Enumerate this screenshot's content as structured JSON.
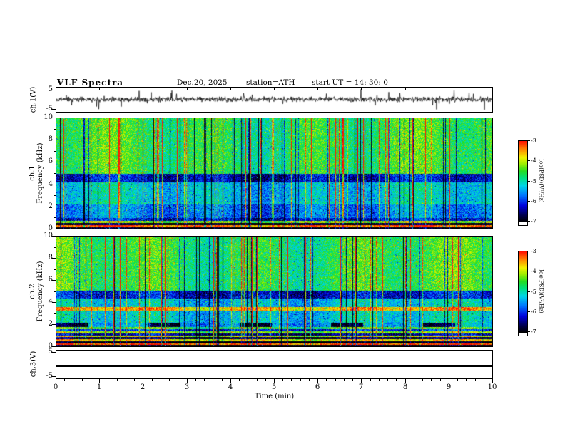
{
  "header": {
    "title": "VLF  Spectra",
    "date": "Dec.20, 2025",
    "station": "station=ATH",
    "start_ut": "start UT  =   14: 30: 0"
  },
  "x_axis": {
    "label": "Time  (min)",
    "ticks": [
      0,
      1,
      2,
      3,
      4,
      5,
      6,
      7,
      8,
      9,
      10
    ],
    "lim": [
      0,
      10
    ],
    "minor_step": 0.2
  },
  "colorbar": {
    "label": "log(PSD)(V²/Hz)",
    "ticks": [
      -3,
      -4,
      -5,
      -6,
      -7
    ],
    "lim": [
      -7,
      -3
    ],
    "colormap": [
      {
        "t": 0.0,
        "c": "#000000"
      },
      {
        "t": 0.08,
        "c": "#00004a"
      },
      {
        "t": 0.2,
        "c": "#0000dd"
      },
      {
        "t": 0.33,
        "c": "#0077ff"
      },
      {
        "t": 0.45,
        "c": "#00d5e8"
      },
      {
        "t": 0.55,
        "c": "#00e07a"
      },
      {
        "t": 0.63,
        "c": "#22dd22"
      },
      {
        "t": 0.72,
        "c": "#9cee00"
      },
      {
        "t": 0.8,
        "c": "#f2f200"
      },
      {
        "t": 0.9,
        "c": "#ff8800"
      },
      {
        "t": 1.0,
        "c": "#ff1100"
      }
    ]
  },
  "chart_data": [
    {
      "type": "line",
      "name": "ch1-waveform",
      "ylabel": "ch.1(V)",
      "yticks": [
        5,
        -5
      ],
      "ylim": [
        -6.5,
        6.5
      ],
      "xlim": [
        0,
        10
      ],
      "description": "broadband noisy voltage waveform around 0 V with impulsive spikes",
      "render": {
        "seed": 11,
        "amp": 1.7,
        "spike_p": 0.03,
        "spike_amp": 4.2
      }
    },
    {
      "type": "heatmap",
      "name": "ch1-spectrogram",
      "ylabel_line1": "ch.1",
      "ylabel_line2": "Frequency (kHz)",
      "yticks": [
        10,
        8,
        6,
        4,
        2,
        0
      ],
      "ylim": [
        0,
        10
      ],
      "xlim": [
        0,
        10
      ],
      "zlim": [
        -7,
        -3
      ],
      "zlabel": "log(PSD)(V²/Hz)",
      "description": "VLF spectrogram: green background above 5 kHz with red/dark sferic streaks, cyan 2.5-4 kHz, dark blue band 4.2-5 kHz, banded hum lines below 1 kHz",
      "render": {
        "seed": 42,
        "base": -4.9,
        "noise": 0.5,
        "streak_bright_p": 0.08,
        "streak_dark_p": 0.07,
        "bands": [
          {
            "lo": 0.0,
            "hi": 0.18,
            "d": -2.2
          },
          {
            "lo": 0.18,
            "hi": 0.34,
            "d": 1.6
          },
          {
            "lo": 0.34,
            "hi": 0.55,
            "d": -2.1
          },
          {
            "lo": 0.55,
            "hi": 0.75,
            "d": 0.7
          },
          {
            "lo": 0.75,
            "hi": 1.0,
            "d": -1.3
          },
          {
            "lo": 1.0,
            "hi": 2.2,
            "d": -0.75
          },
          {
            "lo": 2.2,
            "hi": 2.5,
            "d": -0.2
          },
          {
            "lo": 2.5,
            "hi": 4.2,
            "d": -0.35
          },
          {
            "lo": 4.2,
            "hi": 5.0,
            "d": -1.35
          },
          {
            "lo": 5.0,
            "hi": 10.01,
            "d": 0.3
          }
        ]
      }
    },
    {
      "type": "heatmap",
      "name": "ch2-spectrogram",
      "ylabel_line1": "ch.2",
      "ylabel_line2": "Frequency (kHz)",
      "yticks": [
        10,
        8,
        6,
        4,
        2,
        0
      ],
      "ylim": [
        0,
        10
      ],
      "xlim": [
        0,
        10
      ],
      "zlim": [
        -7,
        -3
      ],
      "zlabel": "log(PSD)(V²/Hz)",
      "description": "VLF spectrogram: similar to ch.1 but with multiple horizontal harmonic lines below 2 kHz, red line near 3.5 kHz and intermittent dark dashes near 2 kHz",
      "render": {
        "seed": 77,
        "base": -4.9,
        "noise": 0.5,
        "streak_bright_p": 0.07,
        "streak_dark_p": 0.07,
        "bands": [
          {
            "lo": 0.0,
            "hi": 0.15,
            "d": -2.3
          },
          {
            "lo": 0.15,
            "hi": 0.3,
            "d": 1.7
          },
          {
            "lo": 0.3,
            "hi": 0.5,
            "d": -2.2
          },
          {
            "lo": 0.5,
            "hi": 0.65,
            "d": 1.1
          },
          {
            "lo": 0.65,
            "hi": 0.85,
            "d": -1.9
          },
          {
            "lo": 0.85,
            "hi": 1.0,
            "d": 0.9
          },
          {
            "lo": 1.0,
            "hi": 1.2,
            "d": -1.5
          },
          {
            "lo": 1.2,
            "hi": 1.38,
            "d": 0.7
          },
          {
            "lo": 1.38,
            "hi": 1.6,
            "d": -1.1
          },
          {
            "lo": 1.6,
            "hi": 1.8,
            "d": 0.4
          },
          {
            "lo": 1.8,
            "hi": 2.2,
            "d": -0.5
          },
          {
            "lo": 2.2,
            "hi": 3.3,
            "d": -0.3
          },
          {
            "lo": 3.3,
            "hi": 3.6,
            "d": 1.3
          },
          {
            "lo": 3.6,
            "hi": 4.4,
            "d": -0.35
          },
          {
            "lo": 4.4,
            "hi": 5.1,
            "d": -1.3
          },
          {
            "lo": 5.1,
            "hi": 10.01,
            "d": 0.3
          }
        ],
        "dash": {
          "lo": 1.8,
          "hi": 2.2,
          "period": 2.1,
          "duty": 0.35,
          "d": -1.6
        }
      }
    },
    {
      "type": "line",
      "name": "ch3-flat",
      "ylabel": "ch.3(V)",
      "yticks": [
        5,
        -5
      ],
      "ylim": [
        -6,
        6
      ],
      "xlim": [
        0,
        10
      ],
      "value": -0.5,
      "description": "flat constant trace (inactive channel)"
    }
  ]
}
